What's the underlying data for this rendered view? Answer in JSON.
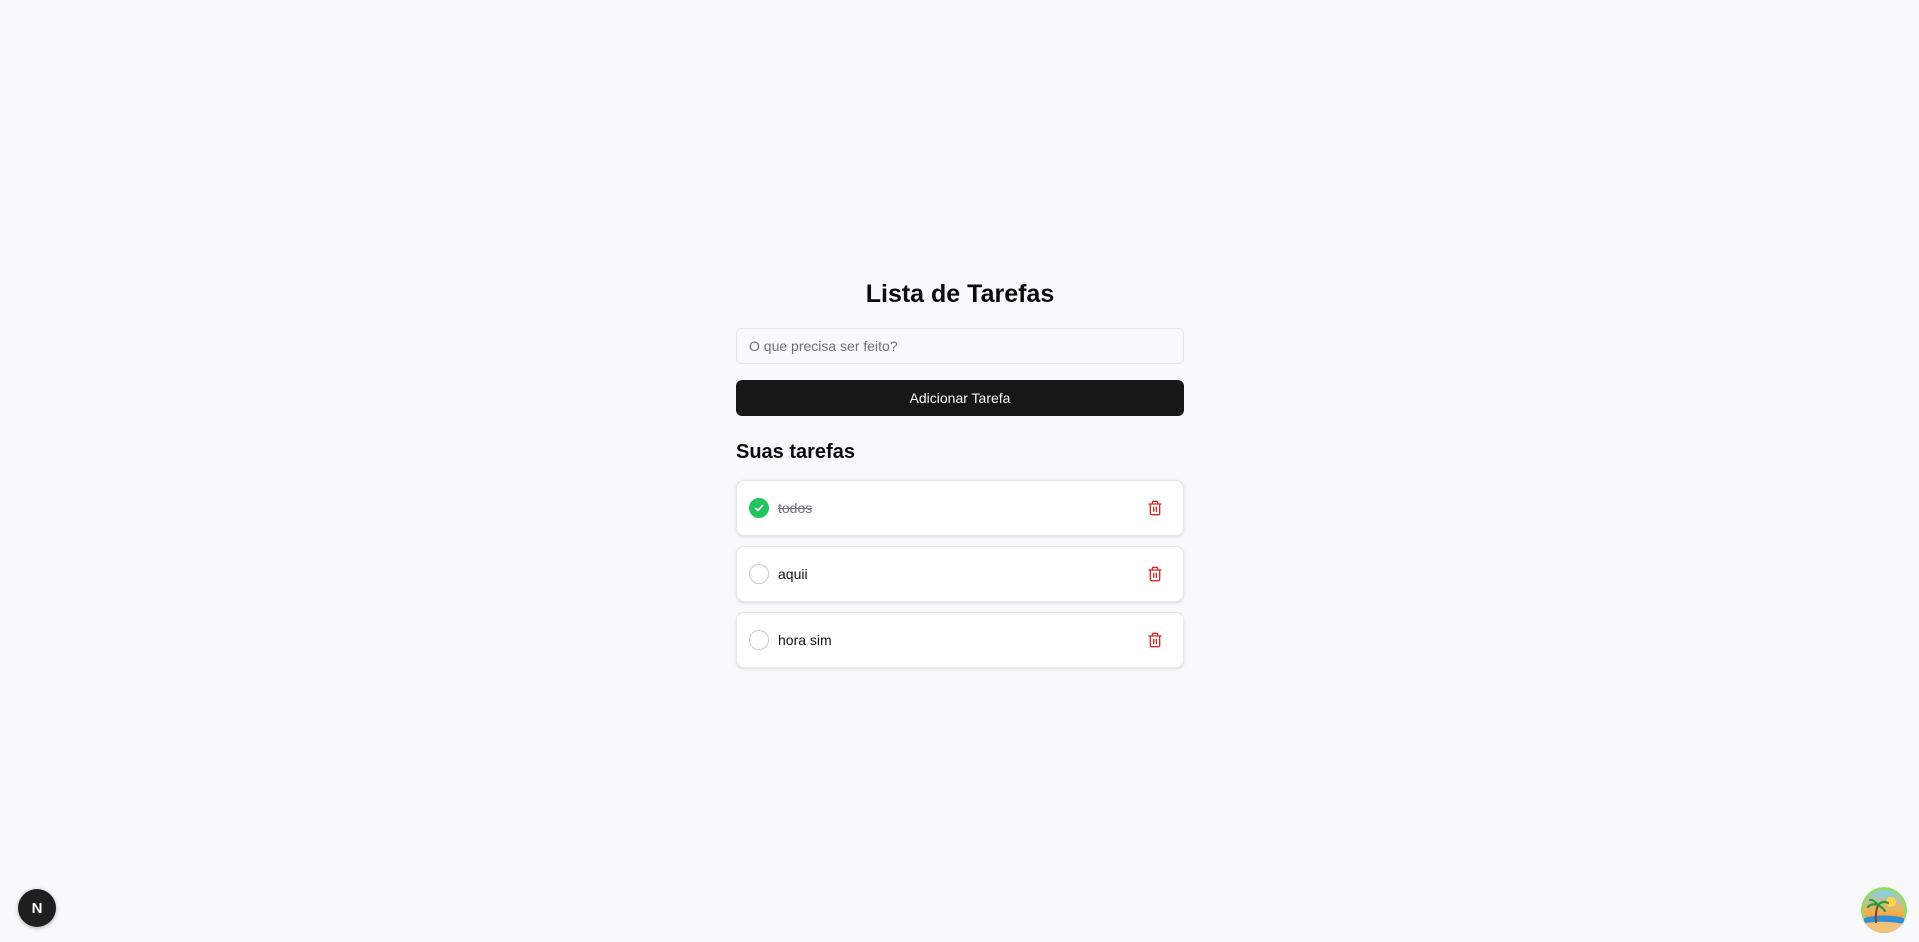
{
  "header": {
    "title": "Lista de Tarefas"
  },
  "form": {
    "input_placeholder": "O que precisa ser feito?",
    "input_value": "",
    "add_button_label": "Adicionar Tarefa"
  },
  "tasks_section": {
    "title": "Suas tarefas",
    "items": [
      {
        "label": "todos",
        "completed": true
      },
      {
        "label": "aquii",
        "completed": false
      },
      {
        "label": "hora sim",
        "completed": false
      }
    ]
  },
  "badges": {
    "framework_badge_letter": "N",
    "avatar_icon": "beach-sunset-avatar-icon"
  },
  "colors": {
    "background": "#f8f9fb",
    "primary_button": "#171717",
    "check_done": "#22c55e",
    "delete_icon": "#dc2626"
  }
}
